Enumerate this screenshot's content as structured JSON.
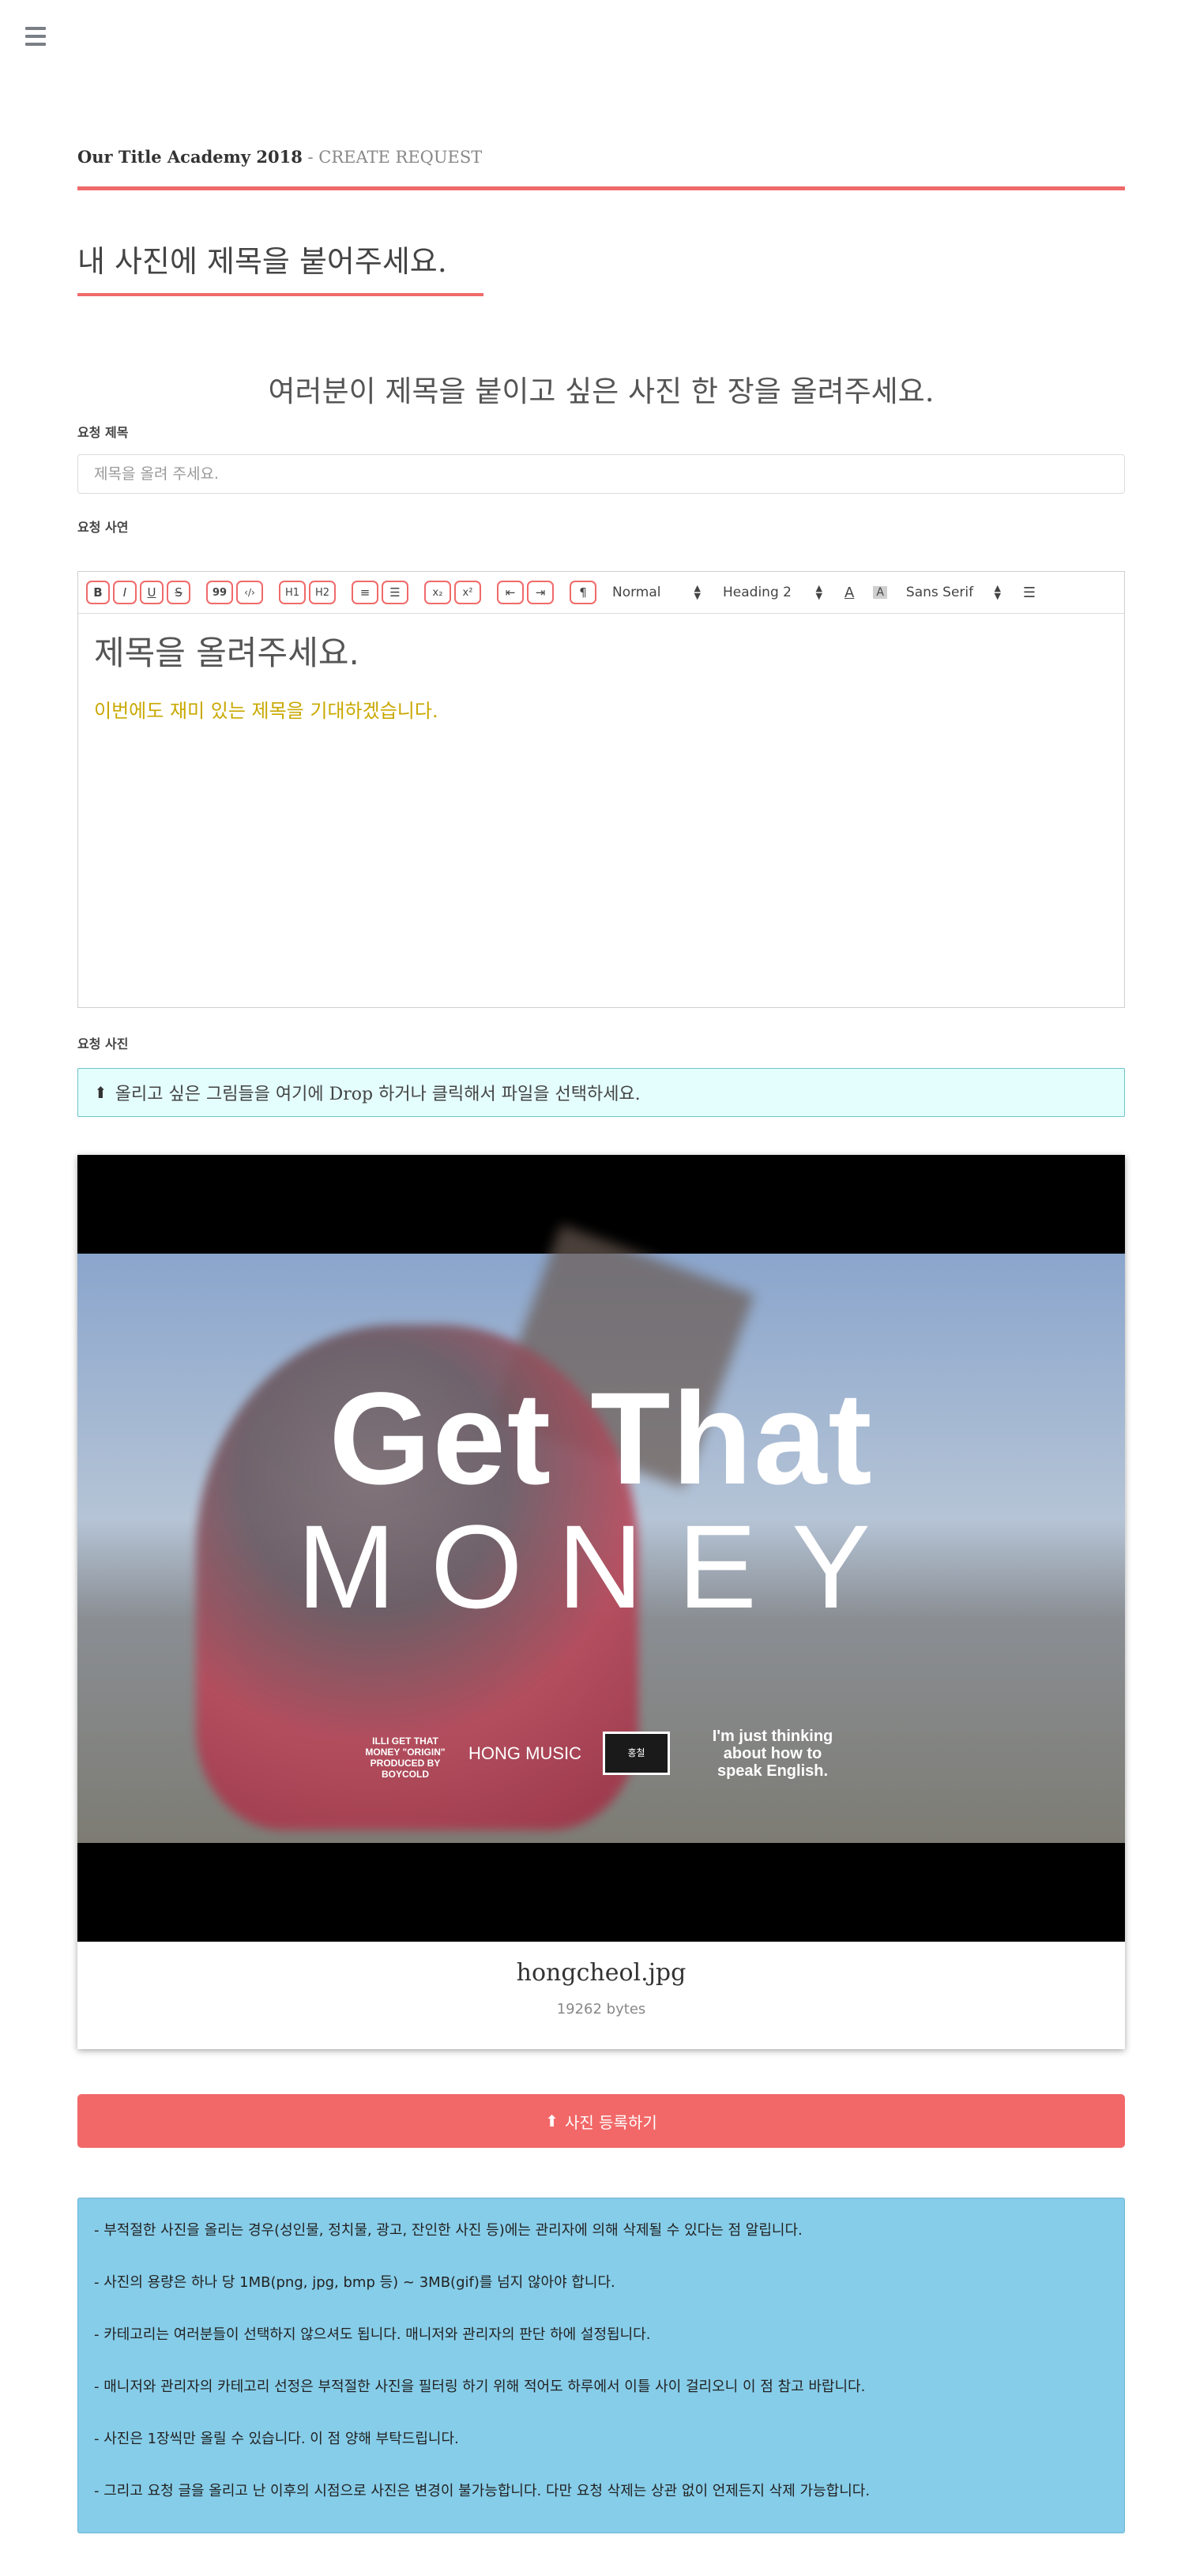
{
  "header": {
    "menu_icon": "hamburger-icon",
    "app_name": "Our Title Academy 2018",
    "separator": " - ",
    "page_name": "CREATE REQUEST"
  },
  "page": {
    "title": "내 사진에 제목을 붙어주세요.",
    "subtitle": "여러분이 제목을 붙이고 싶은 사진 한 장을 올려주세요."
  },
  "form": {
    "title_label": "요청 제목",
    "title_placeholder": "제목을 올려 주세요.",
    "story_label": "요청 사연",
    "photo_label": "요청 사진",
    "dropzone_text": "올리고 싶은 그림들을 여기에 Drop 하거나 클릭해서 파일을 선택하세요.",
    "submit_label": "사진 등록하기"
  },
  "toolbar": {
    "bold": "B",
    "italic": "I",
    "underline": "U",
    "strike": "S",
    "blockquote": "99",
    "code": "‹/›",
    "h1": "H1",
    "h2": "H2",
    "ordered_list": "≡",
    "bullet_list": "☰",
    "subscript": "x₂",
    "superscript": "x²",
    "indent_decrease": "⇤",
    "indent_increase": "⇥",
    "rtl": "¶",
    "size_value": "Normal",
    "header_value": "Heading 2",
    "font_value": "Sans Serif",
    "color_icon": "A",
    "background_icon": "A",
    "align_icon": "align-left-icon"
  },
  "editor": {
    "heading": "제목을 올려주세요.",
    "paragraph": "이번에도 재미 있는 제목을 기대하겠습니다.",
    "paragraph_color": "#c9a800"
  },
  "preview": {
    "image_text_1": "Get That",
    "image_text_2": "MONEY",
    "image_credits": "ILLI GET THAT MONEY \"ORIGIN\" PRODUCED BY BOYCOLD",
    "image_hong": "HONG MUSIC",
    "image_logo": "홍철",
    "image_think": "I'm just thinking about how to speak English.",
    "file_name": "hongcheol.jpg",
    "file_size": "19262 bytes"
  },
  "notices": [
    "- 부적절한 사진을 올리는 경우(성인물, 정치물, 광고, 잔인한 사진 등)에는 관리자에 의해 삭제될 수 있다는 점 알립니다.",
    "- 사진의 용량은 하나 당 1MB(png, jpg, bmp 등) ~ 3MB(gif)를 넘지 않아야 합니다.",
    "- 카테고리는 여러분들이 선택하지 않으셔도 됩니다. 매니저와 관리자의 판단 하에 설정됩니다.",
    "- 매니저와 관리자의 카테고리 선정은 부적절한 사진을 필터링 하기 위해 적어도 하루에서 이틀 사이 걸리오니 이 점 참고 바랍니다.",
    "- 사진은 1장씩만 올릴 수 있습니다. 이 점 양해 부탁드립니다.",
    "- 그리고 요청 글을 올리고 난 이후의 시점으로 사진은 변경이 불가능합니다. 다만 요청 삭제는 상관 없이 언제든지 삭제 가능합니다."
  ],
  "colors": {
    "accent": "#f06a6a",
    "submit_bg": "#f26868",
    "dropzone_bg": "#e4fdfd",
    "notice_bg": "#86cde9"
  }
}
